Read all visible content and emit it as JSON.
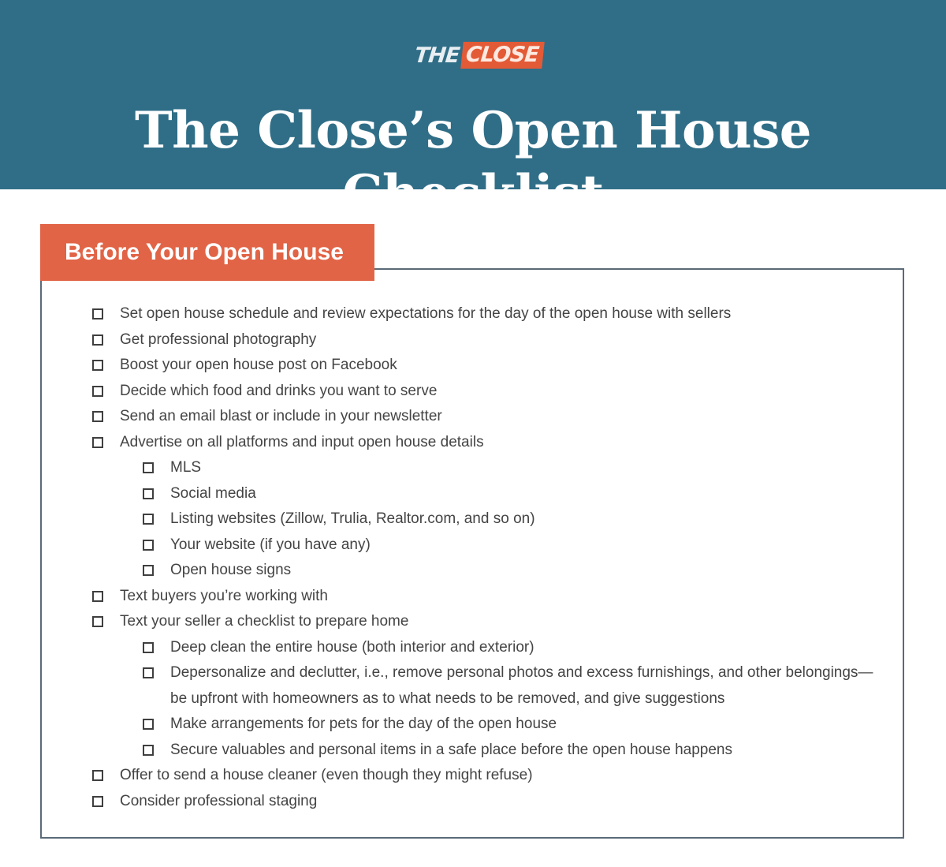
{
  "header": {
    "logo": {
      "part1": "THE",
      "part2": "CLOSE"
    },
    "title": "The Close’s Open House Checklist"
  },
  "colors": {
    "header_bg": "#306e87",
    "accent": "#e16446",
    "border": "#5a6a77"
  },
  "section": {
    "title": "Before Your Open House",
    "items": [
      {
        "level": 1,
        "text": "Set open house schedule and review expectations for the day of the open house with sellers",
        "checked": false
      },
      {
        "level": 1,
        "text": "Get professional photography",
        "checked": false
      },
      {
        "level": 1,
        "text": "Boost your open house post on Facebook",
        "checked": false
      },
      {
        "level": 1,
        "text": "Decide which food and drinks you want to serve",
        "checked": false
      },
      {
        "level": 1,
        "text": "Send an email blast or include in your newsletter",
        "checked": false
      },
      {
        "level": 1,
        "text": "Advertise on all platforms and input open house details",
        "checked": false
      },
      {
        "level": 2,
        "text": "MLS",
        "checked": false
      },
      {
        "level": 2,
        "text": "Social media",
        "checked": false
      },
      {
        "level": 2,
        "text": "Listing websites (Zillow, Trulia, Realtor.com, and so on)",
        "checked": false
      },
      {
        "level": 2,
        "text": "Your website (if you have any)",
        "checked": false
      },
      {
        "level": 2,
        "text": "Open house signs",
        "checked": false
      },
      {
        "level": 1,
        "text": "Text buyers you’re working with",
        "checked": false
      },
      {
        "level": 1,
        "text": "Text your seller a checklist to prepare home",
        "checked": false
      },
      {
        "level": 2,
        "text": "Deep clean the entire house (both interior and exterior)",
        "checked": false
      },
      {
        "level": 2,
        "text": "Depersonalize and declutter, i.e., remove personal photos and excess furnishings, and other belongings—be upfront with homeowners as to what needs to be removed, and give suggestions",
        "checked": false
      },
      {
        "level": 2,
        "text": "Make arrangements for pets for the day of the open house",
        "checked": false
      },
      {
        "level": 2,
        "text": "Secure valuables and personal items in a safe place before the open house happens",
        "checked": false
      },
      {
        "level": 1,
        "text": "Offer to send a house cleaner (even though they might refuse)",
        "checked": false
      },
      {
        "level": 1,
        "text": "Consider professional staging",
        "checked": false
      }
    ]
  }
}
